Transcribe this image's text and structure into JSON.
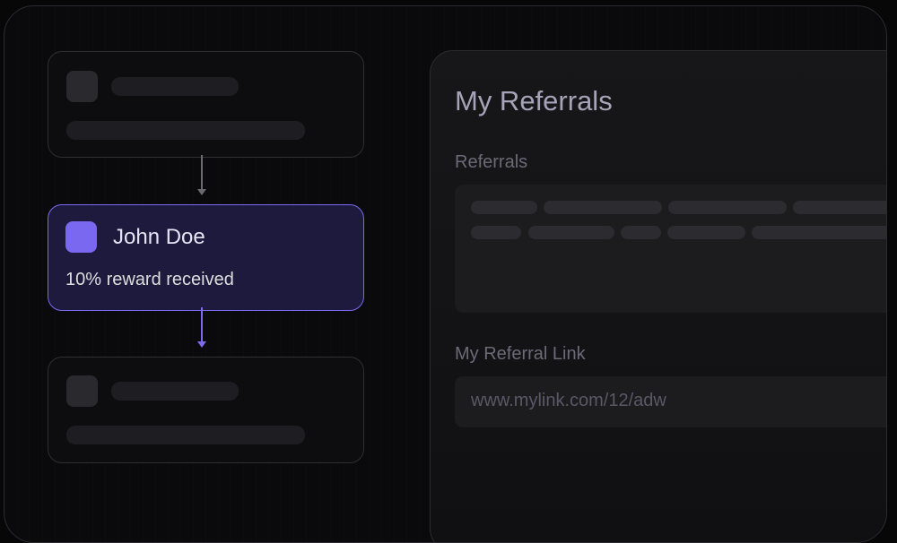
{
  "flow": {
    "active_card": {
      "name": "John Doe",
      "status": "10% reward received",
      "avatar_color": "#7a68f0"
    }
  },
  "panel": {
    "title": "My Referrals",
    "referrals_label": "Referrals",
    "referral_link_label": "My Referral Link",
    "referral_link_value": "www.mylink.com/12/adw"
  },
  "colors": {
    "accent": "#7d6af0",
    "background": "#070708",
    "card_active_bg": "#1e1a3e"
  }
}
